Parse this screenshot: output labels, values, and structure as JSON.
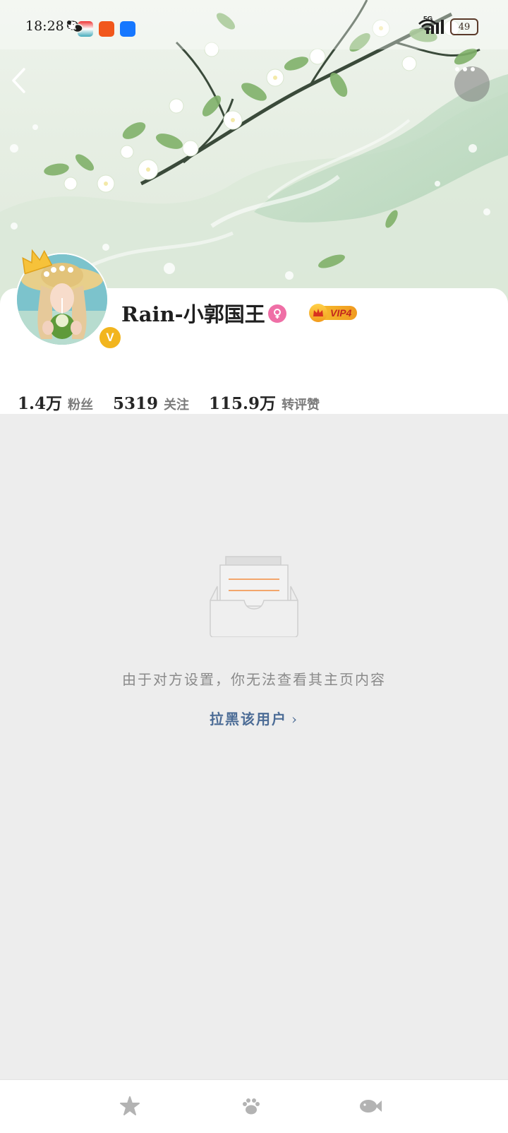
{
  "status_bar": {
    "time": "18:28",
    "network": "5G",
    "battery": "49",
    "notification_icons": [
      "wechat-icon",
      "check-icon",
      "game-app-icon",
      "taobao-icon",
      "alipay-icon",
      "more-dot-icon"
    ]
  },
  "header": {
    "back_icon": "back-chevron-icon",
    "more_icon": "more-dots-icon"
  },
  "profile": {
    "username": "Rain-小郭国王",
    "gender_icon": "female-icon",
    "vip_label": "VIP4",
    "verified_badge": "V",
    "stats": [
      {
        "value": "1.4万",
        "label": "粉丝"
      },
      {
        "value": "5319",
        "label": "关注"
      },
      {
        "value": "115.9万",
        "label": "转评赞"
      }
    ]
  },
  "empty_state": {
    "message": "由于对方设置，你无法查看其主页内容",
    "action_label": "拉黑该用户",
    "action_chevron": "›"
  },
  "bottom_bar": {
    "icons": [
      "starfish-icon",
      "paw-icon",
      "fish-icon"
    ]
  },
  "colors": {
    "link": "#4c6c96",
    "vip_gold": "#f6b92c",
    "verified": "#f2b51e",
    "gender_pink": "#ef6fa6",
    "background": "#ededed"
  }
}
